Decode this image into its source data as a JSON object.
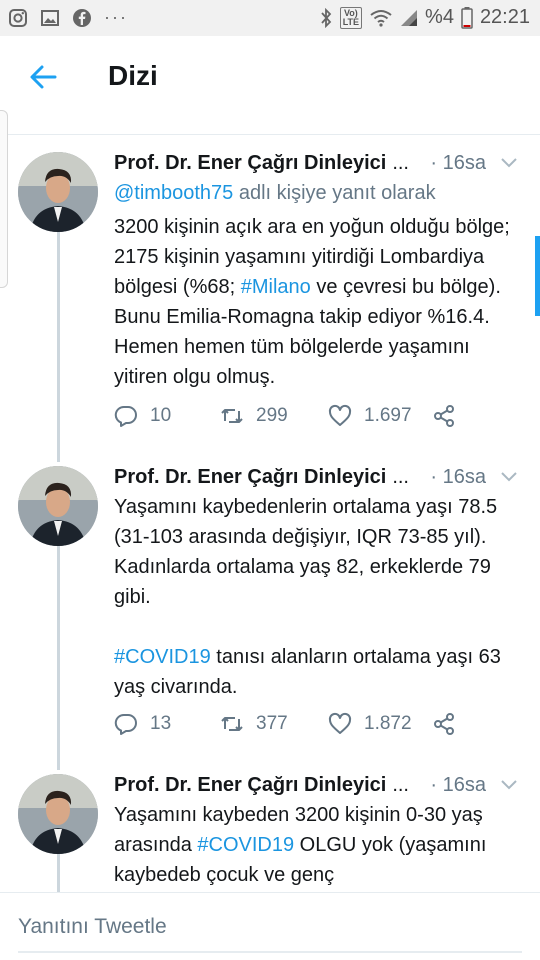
{
  "status_bar": {
    "icons_left": [
      "instagram-icon",
      "gallery-icon",
      "facebook-icon"
    ],
    "more": "···",
    "volte": "Vo)) LTE",
    "battery": "%4",
    "time": "22:21"
  },
  "header": {
    "title": "Dizi"
  },
  "accent_color": "#1da1f2",
  "tweets": [
    {
      "author": "Prof. Dr. Ener Çağrı Dinleyici",
      "ellipsis": "...",
      "time": "· 16sa",
      "reply_mention": "@timbooth75",
      "reply_suffix": " adlı kişiye yanıt olarak",
      "text_a": "3200 kişinin açık ara en yoğun olduğu bölge; 2175 kişinin yaşamını yitirdiği Lombardiya bölgesi (%68; ",
      "hashtag": "#Milano",
      "text_b": " ve çevresi bu bölge). Bunu Emilia-Romagna takip ediyor %16.4. Hemen hemen tüm bölgelerde yaşamını yitiren olgu olmuş.",
      "replies": "10",
      "retweets": "299",
      "likes": "1.697"
    },
    {
      "author": "Prof. Dr. Ener Çağrı Dinleyici",
      "ellipsis": "...",
      "time": "· 16sa",
      "text_a": "Yaşamını kaybedenlerin ortalama yaşı 78.5 (31-103 arasında değişiyır, IQR 73-85 yıl). Kadınlarda ortalama yaş 82, erkeklerde 79 gibi.",
      "hashtag": "#COVID19",
      "text_b": " tanısı alanların ortalama yaşı 63 yaş civarında.",
      "replies": "13",
      "retweets": "377",
      "likes": "1.872"
    },
    {
      "author": "Prof. Dr. Ener Çağrı Dinleyici",
      "ellipsis": "...",
      "time": "· 16sa",
      "text_a": "Yaşamını kaybeden 3200 kişinin 0-30 yaş arasında ",
      "hashtag": "#COVID19",
      "text_b": " OLGU yok (yaşamını kaybedeb çocuk ve genç"
    }
  ],
  "reply_bar": {
    "placeholder": "Yanıtını Tweetle"
  }
}
